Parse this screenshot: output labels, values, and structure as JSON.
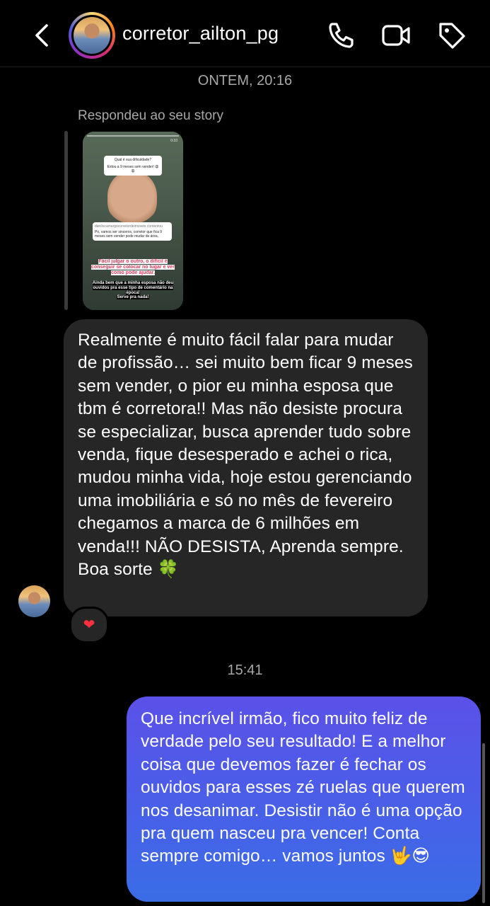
{
  "header": {
    "back_icon": "chevron-left-icon",
    "username": "corretor_ailton_pg",
    "icons": [
      "phone-icon",
      "video-camera-icon",
      "tag-icon"
    ]
  },
  "thread": {
    "timestamp_1": "ONTEM, 20:16",
    "reply_label": "Respondeu ao seu story",
    "story": {
      "question": "Qual é sua dificuldade?",
      "answer": "Estou a 9 meses sem vender! 😩😩",
      "comment_user": "danilocamargocorretordeimoveis comentou",
      "comment_text": "Po, vamos ser sinceros, corretor que fica 9 meses sem vender pode mudar de área,",
      "pink_caption": "Fácil julgar o outro, o difícil é conseguir se colocar no lugar e ver como pode ajudar.",
      "black_caption": "Ainda bem que a minha esposa não deu ouvidos pra esse tipo de comentário na época!",
      "bottom_caption": "Serve pra nada!",
      "time": "0:33"
    },
    "incoming_message": "Realmente é muito fácil falar para mudar de profissão… sei muito bem ficar 9 meses sem vender, o pior eu minha esposa que tbm é corretora!! Mas não desiste procura se especializar, busca aprender tudo sobre venda, fique desesperado e achei o rica, mudou minha vida, hoje estou gerenciando uma imobiliária e só no mês de fevereiro chegamos a marca de 6 milhões em venda!!! NÃO DESISTA, Aprenda sempre. Boa sorte 🍀",
    "reaction": "❤",
    "timestamp_2": "15:41",
    "outgoing_message": "Que incrível irmão, fico muito feliz de verdade pelo seu resultado! E a melhor coisa que devemos fazer é fechar os ouvidos para esses zé ruelas que querem nos desanimar. Desistir não é uma opção pra quem nasceu pra vencer! Conta sempre comigo… vamos juntos 🤟😎"
  },
  "colors": {
    "background": "#000000",
    "incoming_bubble": "#262626",
    "outgoing_bubble_top": "#5b51e8",
    "outgoing_bubble_bottom": "#3a6de6",
    "muted_text": "#a8a8a8"
  }
}
